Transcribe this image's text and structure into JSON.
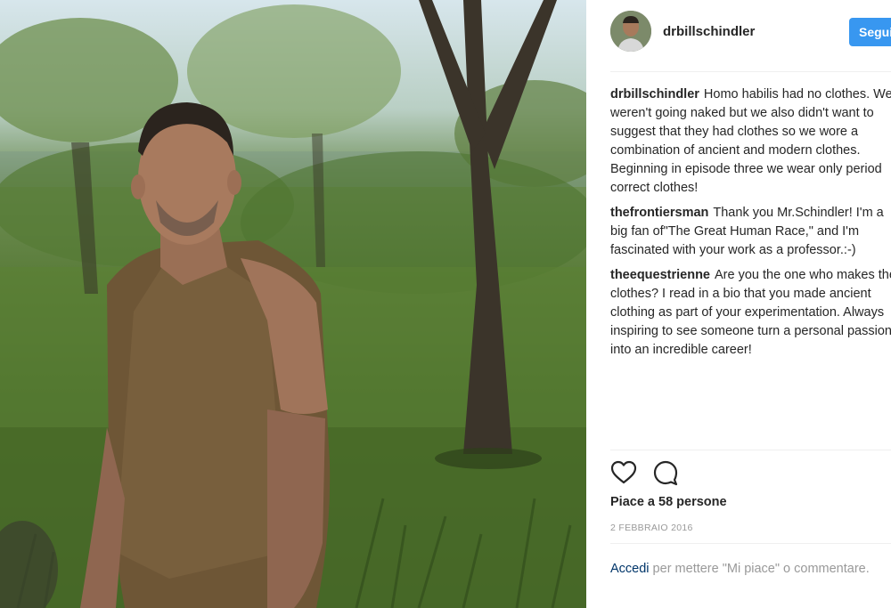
{
  "post": {
    "username": "drbillschindler",
    "follow_label": "Segui",
    "likes_text": "Piace a 58 persone",
    "date": "2 FEBBRAIO 2016",
    "login_link": "Accedi",
    "login_rest": " per mettere \"Mi piace\" o commentare."
  },
  "comments": [
    {
      "user": "drbillschindler",
      "text": "Homo habilis had no clothes. We weren't going naked but we also didn't want to suggest that they had clothes so we wore a combination of ancient and modern clothes. Beginning in episode three we wear only period correct clothes!"
    },
    {
      "user": "thefrontiersman",
      "text": "Thank you Mr.Schindler! I'm a big fan of\"The Great Human Race,\" and I'm fascinated with your work as a professor.:-)"
    },
    {
      "user": "theequestrienne",
      "text": "Are you the one who makes the clothes? I read in a bio that you made ancient clothing as part of your experimentation. Always inspiring to see someone turn a personal passion into an incredible career!"
    }
  ],
  "icons": {
    "like": "heart-icon",
    "comment": "comment-bubble-icon"
  },
  "colors": {
    "follow_button": "#3897f0",
    "link": "#003569",
    "muted": "#999999"
  }
}
